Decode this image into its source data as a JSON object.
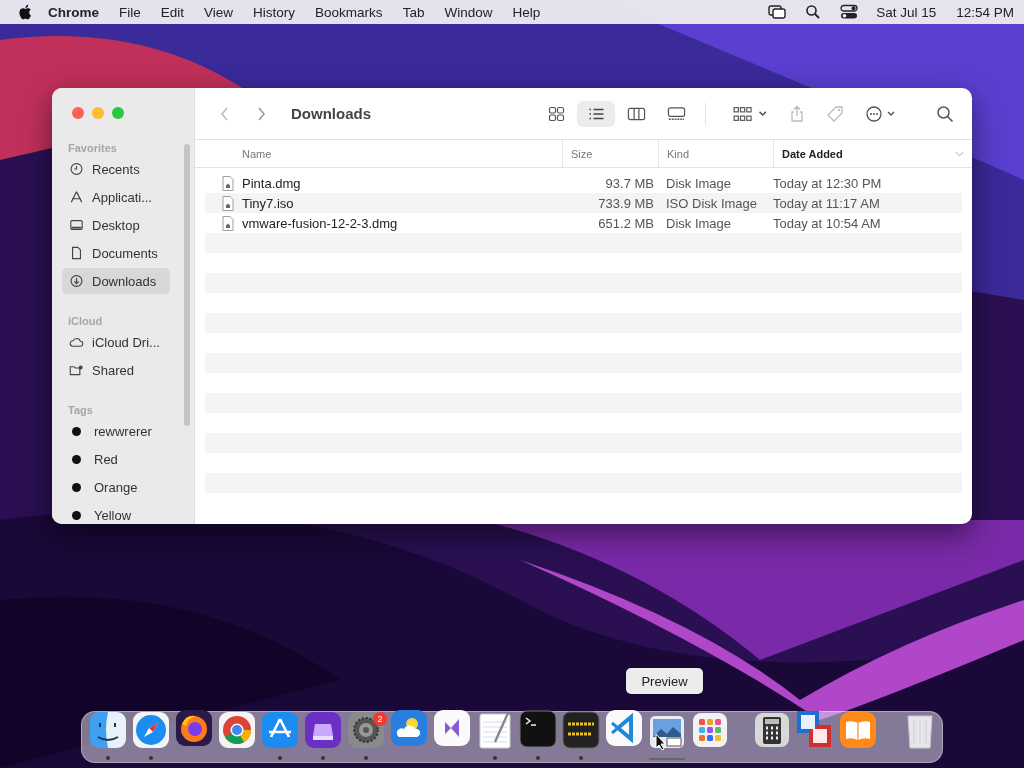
{
  "menu_bar": {
    "app": "Chrome",
    "menus": [
      "File",
      "Edit",
      "View",
      "History",
      "Bookmarks",
      "Tab",
      "Window",
      "Help"
    ],
    "date": "Sat Jul 15",
    "time": "12:54 PM"
  },
  "finder": {
    "title": "Downloads",
    "views": [
      {
        "kind": "icons",
        "selected": false
      },
      {
        "kind": "list",
        "selected": true
      },
      {
        "kind": "columns",
        "selected": false
      },
      {
        "kind": "gallery",
        "selected": false
      }
    ],
    "sidebar": [
      {
        "heading": "Favorites",
        "items": [
          {
            "label": "Recents",
            "kind": "clock",
            "selected": false
          },
          {
            "label": "Applicati...",
            "kind": "apps",
            "selected": false
          },
          {
            "label": "Desktop",
            "kind": "desktop",
            "selected": false
          },
          {
            "label": "Documents",
            "kind": "doc",
            "selected": false
          },
          {
            "label": "Downloads",
            "kind": "download",
            "selected": true
          }
        ]
      },
      {
        "heading": "iCloud",
        "items": [
          {
            "label": "iCloud Dri...",
            "kind": "cloud",
            "selected": false
          },
          {
            "label": "Shared",
            "kind": "folder",
            "selected": false
          }
        ]
      },
      {
        "heading": "Tags",
        "items": [
          {
            "label": "rewwrerer",
            "kind": "tag",
            "selected": false
          },
          {
            "label": "Red",
            "kind": "tag",
            "selected": false
          },
          {
            "label": "Orange",
            "kind": "tag",
            "selected": false
          },
          {
            "label": "Yellow",
            "kind": "tag",
            "selected": false
          }
        ]
      }
    ],
    "columns": [
      {
        "label": "Name",
        "selected": false
      },
      {
        "label": "Size",
        "selected": false
      },
      {
        "label": "Kind",
        "selected": false
      },
      {
        "label": "Date Added",
        "selected": true
      }
    ],
    "files": [
      {
        "name": "Pinta.dmg",
        "size": "93.7 MB",
        "kind": "Disk Image",
        "date": "Today at 12:30 PM"
      },
      {
        "name": "Tiny7.iso",
        "size": "733.9 MB",
        "kind": "ISO Disk Image",
        "date": "Today at 11:17 AM"
      },
      {
        "name": "vmware-fusion-12-2-3.dmg",
        "size": "651.2 MB",
        "kind": "Disk Image",
        "date": "Today at 10:54 AM"
      }
    ]
  },
  "dock": {
    "tooltip": "Preview",
    "items": [
      {
        "kind": "finder",
        "running": true
      },
      {
        "kind": "safari",
        "running": true
      },
      {
        "kind": "firefox",
        "running": false
      },
      {
        "kind": "chrome",
        "running": false
      },
      {
        "kind": "appstore",
        "running": true
      },
      {
        "kind": "podcasts",
        "running": true
      },
      {
        "kind": "settings",
        "running": true,
        "badge": "2"
      },
      {
        "kind": "weather",
        "running": false
      },
      {
        "kind": "studio",
        "running": false
      },
      {
        "kind": "textedit",
        "running": true
      },
      {
        "kind": "terminal",
        "running": true
      },
      {
        "kind": "console",
        "running": true
      },
      {
        "kind": "vscode",
        "running": false
      },
      {
        "kind": "preview",
        "running": true
      },
      {
        "kind": "launchpad",
        "running": false
      },
      {
        "kind": "separator"
      },
      {
        "kind": "calculator",
        "running": false
      },
      {
        "kind": "vmware",
        "running": false
      },
      {
        "kind": "books",
        "running": false
      },
      {
        "kind": "separator"
      },
      {
        "kind": "trash",
        "running": false
      }
    ]
  }
}
